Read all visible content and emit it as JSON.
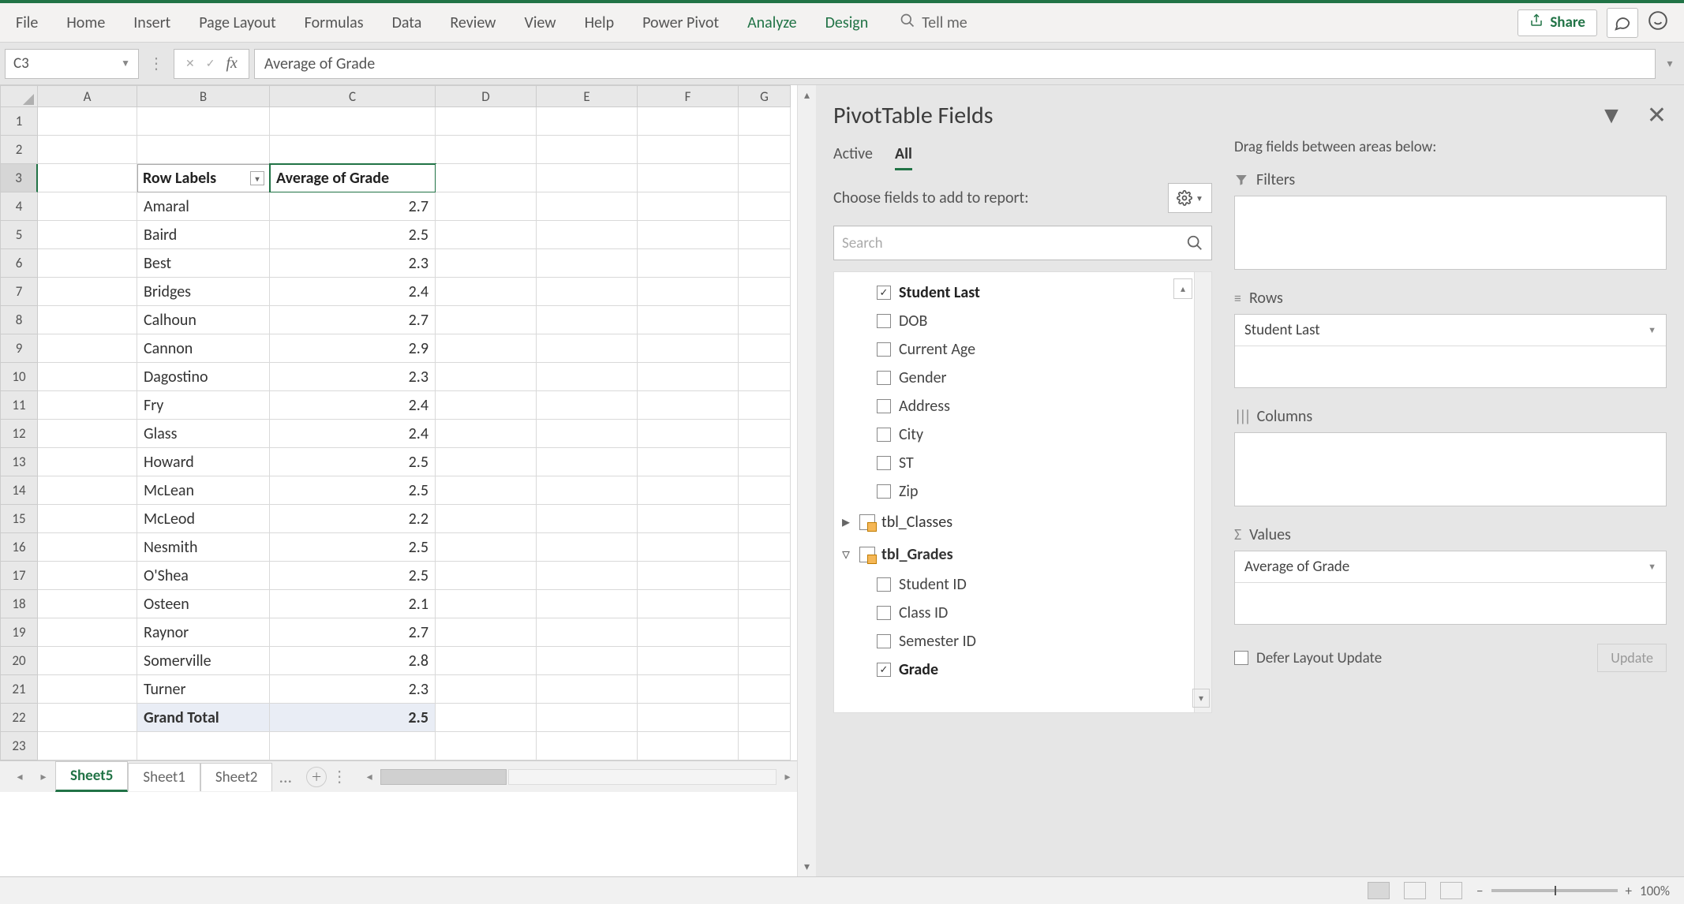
{
  "ribbon": {
    "tabs": [
      "File",
      "Home",
      "Insert",
      "Page Layout",
      "Formulas",
      "Data",
      "Review",
      "View",
      "Help",
      "Power Pivot"
    ],
    "contextual": [
      "Analyze",
      "Design"
    ],
    "tellme": "Tell me",
    "share": "Share"
  },
  "formula": {
    "nameBox": "C3",
    "content": "Average of Grade"
  },
  "columns": [
    "A",
    "B",
    "C",
    "D",
    "E",
    "F",
    "G"
  ],
  "pivotHeaders": {
    "rowLabels": "Row Labels",
    "value": "Average of Grade"
  },
  "pivotData": [
    {
      "label": "Amaral",
      "value": "2.7"
    },
    {
      "label": "Baird",
      "value": "2.5"
    },
    {
      "label": "Best",
      "value": "2.3"
    },
    {
      "label": "Bridges",
      "value": "2.4"
    },
    {
      "label": "Calhoun",
      "value": "2.7"
    },
    {
      "label": "Cannon",
      "value": "2.9"
    },
    {
      "label": "Dagostino",
      "value": "2.3"
    },
    {
      "label": "Fry",
      "value": "2.4"
    },
    {
      "label": "Glass",
      "value": "2.4"
    },
    {
      "label": "Howard",
      "value": "2.5"
    },
    {
      "label": "McLean",
      "value": "2.5"
    },
    {
      "label": "McLeod",
      "value": "2.2"
    },
    {
      "label": "Nesmith",
      "value": "2.5"
    },
    {
      "label": "O'Shea",
      "value": "2.5"
    },
    {
      "label": "Osteen",
      "value": "2.1"
    },
    {
      "label": "Raynor",
      "value": "2.7"
    },
    {
      "label": "Somerville",
      "value": "2.8"
    },
    {
      "label": "Turner",
      "value": "2.3"
    }
  ],
  "grandTotal": {
    "label": "Grand Total",
    "value": "2.5"
  },
  "sheetTabs": {
    "active": "Sheet5",
    "others": [
      "Sheet1",
      "Sheet2"
    ],
    "ellipsis": "..."
  },
  "panel": {
    "title": "PivotTable Fields",
    "tabs": {
      "active": "Active",
      "all": "All"
    },
    "choose": "Choose fields to add to report:",
    "search": "Search",
    "studentFields": [
      {
        "label": "Student Last",
        "checked": true
      },
      {
        "label": "DOB",
        "checked": false
      },
      {
        "label": "Current Age",
        "checked": false
      },
      {
        "label": "Gender",
        "checked": false
      },
      {
        "label": "Address",
        "checked": false
      },
      {
        "label": "City",
        "checked": false
      },
      {
        "label": "ST",
        "checked": false
      },
      {
        "label": "Zip",
        "checked": false
      }
    ],
    "tbl_classes": "tbl_Classes",
    "tbl_grades": "tbl_Grades",
    "gradeFields": [
      {
        "label": "Student ID",
        "checked": false
      },
      {
        "label": "Class ID",
        "checked": false
      },
      {
        "label": "Semester ID",
        "checked": false
      },
      {
        "label": "Grade",
        "checked": true
      }
    ],
    "instr": "Drag fields between areas below:",
    "areas": {
      "filters": "Filters",
      "rows": "Rows",
      "columns": "Columns",
      "values": "Values"
    },
    "rowsItem": "Student Last",
    "valuesItem": "Average of Grade",
    "defer": "Defer Layout Update",
    "update": "Update"
  },
  "status": {
    "zoom": "100%"
  }
}
